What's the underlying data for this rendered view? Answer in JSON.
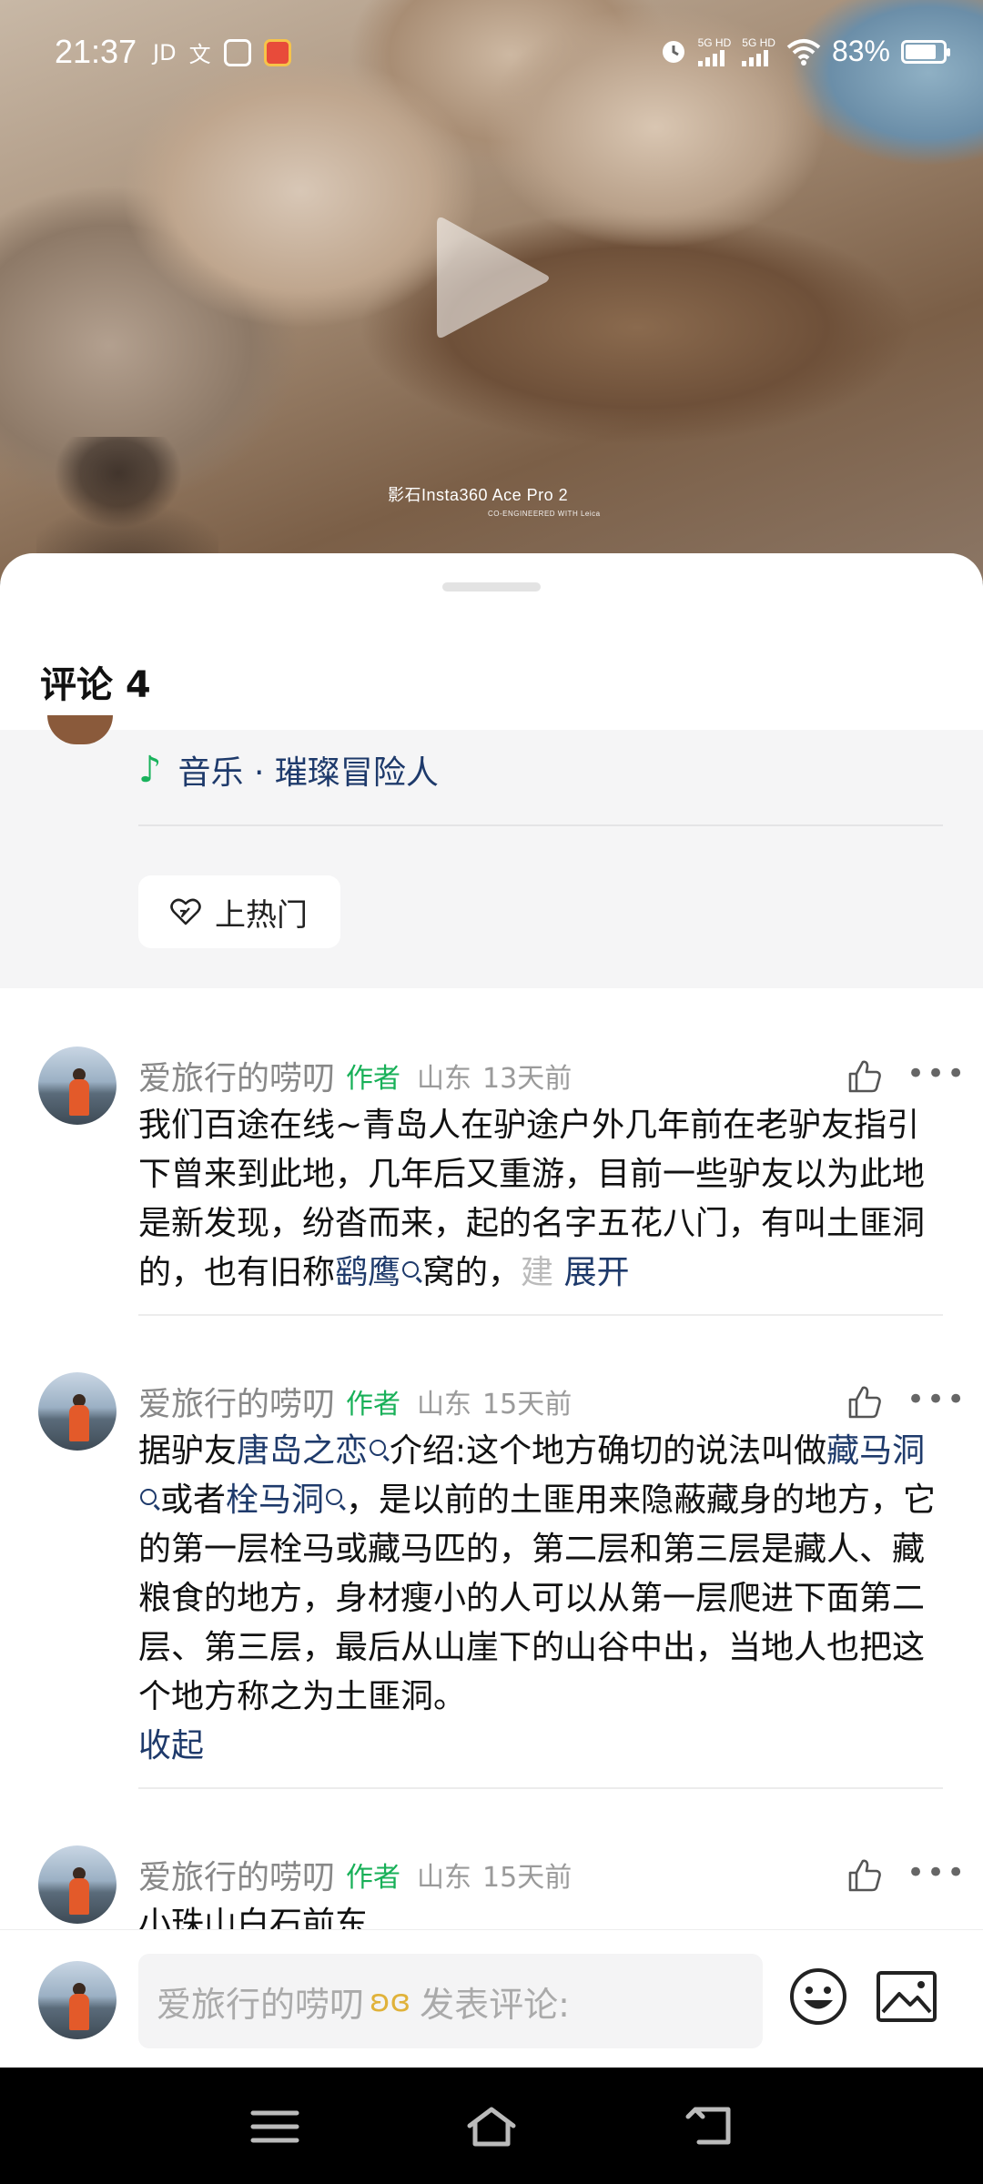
{
  "status_bar": {
    "time": "21:37",
    "left_icons": [
      "JD",
      "文"
    ],
    "net1": "5G HD",
    "net2": "5G HD",
    "battery": "83%",
    "battery_level": 0.83
  },
  "video": {
    "watermark": "影石Insta360 Ace Pro 2",
    "watermark_sub": "CO-ENGINEERED WITH Leica"
  },
  "sheet": {
    "title": "评论 4"
  },
  "post": {
    "music": "音乐 · 璀璨冒险人",
    "hot_button": "上热门"
  },
  "comments": [
    {
      "name": "爱旅行的唠叨",
      "badge": "作者",
      "location": "山东",
      "time": "13天前",
      "body_part1": "我们百途在线~青岛人在驴途户外几年前在老驴友指引下曾来到此地，几年后又重游，目前一些驴友以为此地是新发现，纷沓而来，起的名字五花八门，有叫土匪洞的，也有旧称",
      "link1": "鹞鹰",
      "body_part2": "窝的，",
      "faded": "建",
      "expand": "展开"
    },
    {
      "name": "爱旅行的唠叨",
      "badge": "作者",
      "location": "山东",
      "time": "15天前",
      "body_part1": "据驴友",
      "link1": "唐岛之恋",
      "body_part2": "介绍:这个地方确切的说法叫做",
      "link2": "藏马洞",
      "body_part3": "或者",
      "link3": "栓马洞",
      "body_part4": "，是以前的土匪用来隐蔽藏身的地方，它的第一层栓马或藏马匹的，第二层和第三层是藏人、藏粮食的地方，身材瘦小的人可以从第一层爬进下面第二层、第三层，最后从山崖下的山谷中出，当地人也把这个地方称之为土匪洞。",
      "collapse": "收起"
    },
    {
      "name": "爱旅行的唠叨",
      "badge": "作者",
      "location": "山东",
      "time": "15天前",
      "body": "小珠山白石前东"
    }
  ],
  "input": {
    "user": "爱旅行的唠叨",
    "placeholder": "发表评论:"
  },
  "icons": {
    "like": "thumbs-up-icon",
    "more": "more-icon",
    "emoji": "emoji-icon",
    "image": "image-icon",
    "music": "music-note-icon",
    "hot": "heart-flame-icon"
  },
  "colors": {
    "link": "#1e3a6b",
    "author_badge": "#18b058",
    "music_note": "#19b25c"
  }
}
